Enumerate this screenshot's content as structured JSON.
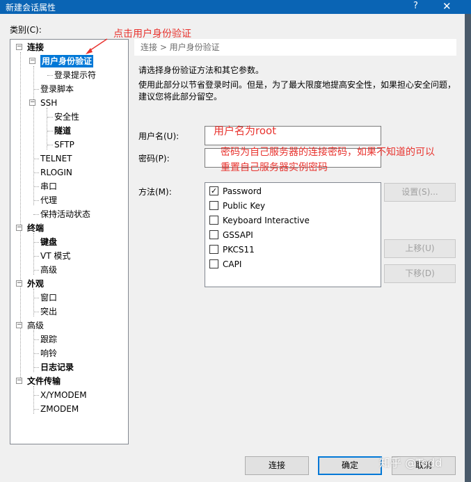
{
  "window": {
    "title": "新建会话属性",
    "help_icon": "?",
    "close_icon": "✕"
  },
  "category_label": "类别(C):",
  "tree": [
    {
      "label": "连接",
      "bold": true,
      "expander": "−"
    },
    {
      "label": "用户身份验证",
      "bold": true,
      "selected": true,
      "expander": "−"
    },
    {
      "label": "登录提示符"
    },
    {
      "label": "登录脚本"
    },
    {
      "label": "SSH",
      "expander": "−"
    },
    {
      "label": "安全性"
    },
    {
      "label": "隧道",
      "bold": true
    },
    {
      "label": "SFTP"
    },
    {
      "label": "TELNET"
    },
    {
      "label": "RLOGIN"
    },
    {
      "label": "串口"
    },
    {
      "label": "代理"
    },
    {
      "label": "保持活动状态"
    },
    {
      "label": "终端",
      "bold": true,
      "expander": "−"
    },
    {
      "label": "键盘",
      "bold": true
    },
    {
      "label": "VT 模式"
    },
    {
      "label": "高级"
    },
    {
      "label": "外观",
      "bold": true,
      "expander": "−"
    },
    {
      "label": "窗口"
    },
    {
      "label": "突出"
    },
    {
      "label": "高级",
      "expander": "−"
    },
    {
      "label": "跟踪"
    },
    {
      "label": "响铃"
    },
    {
      "label": "日志记录",
      "bold": true
    },
    {
      "label": "文件传输",
      "bold": true,
      "expander": "−"
    },
    {
      "label": "X/YMODEM"
    },
    {
      "label": "ZMODEM"
    }
  ],
  "annotations": {
    "click_hint": "点击用户身份验证",
    "username_hint": "用户名为root",
    "password_hint_line1": "密码为自己服务器的连接密码，如果不知道的可以",
    "password_hint_line2": "重置自己服务器实例密码"
  },
  "breadcrumb": "连接 > 用户身份验证",
  "description": {
    "line1": "请选择身份验证方法和其它参数。",
    "line2": "使用此部分以节省登录时间。但是，为了最大限度地提高安全性，如果担心安全问题，建议您将此部分留空。"
  },
  "fields": {
    "username_label": "用户名(U):",
    "username_value": "",
    "password_label": "密码(P):",
    "password_value": "",
    "method_label": "方法(M):"
  },
  "methods": [
    {
      "label": "Password",
      "checked": true
    },
    {
      "label": "Public Key",
      "checked": false
    },
    {
      "label": "Keyboard Interactive",
      "checked": false
    },
    {
      "label": "GSSAPI",
      "checked": false
    },
    {
      "label": "PKCS11",
      "checked": false
    },
    {
      "label": "CAPI",
      "checked": false
    }
  ],
  "side_buttons": {
    "settings": "设置(S)...",
    "move_up": "上移(U)",
    "move_down": "下移(D)"
  },
  "footer_buttons": {
    "connect": "连接",
    "ok": "确定",
    "cancel": "取消"
  },
  "watermark": "知乎 @Todd"
}
